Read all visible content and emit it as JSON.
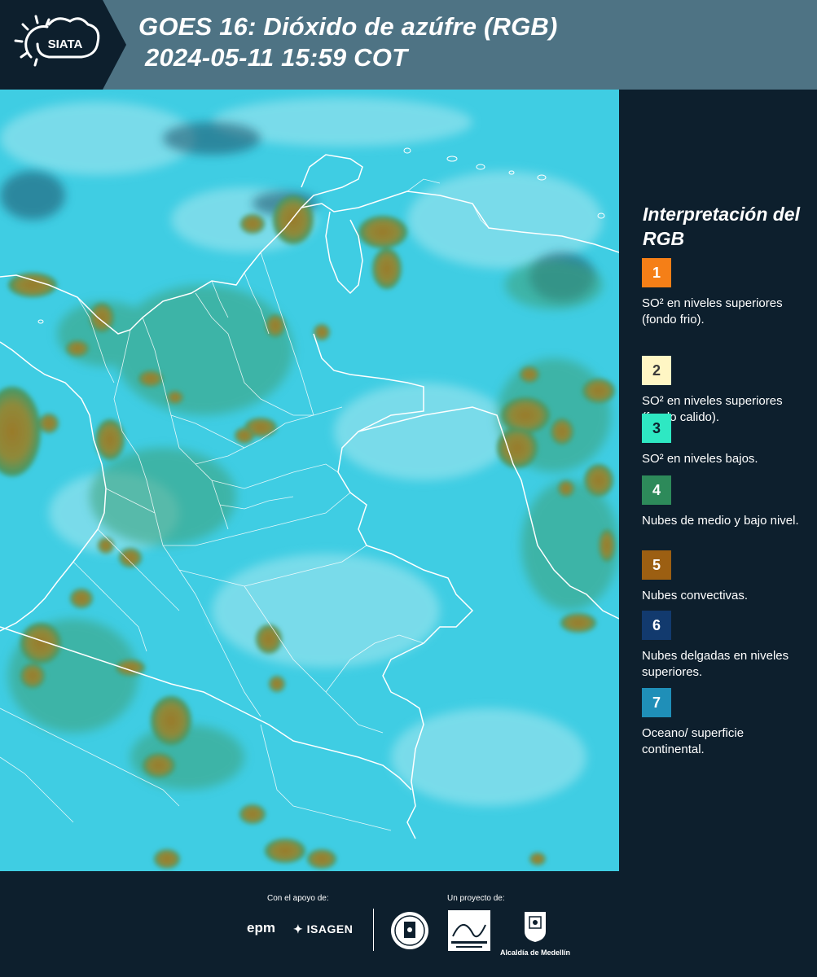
{
  "header": {
    "logo_text": "SIATA",
    "title_line1": "GOES 16: Dióxido de azúfre (RGB)",
    "title_line2": "2024-05-11 15:59 COT"
  },
  "legend": {
    "title": "Interpretación del RGB",
    "items": [
      {
        "number": "1",
        "color": "#f57f17",
        "number_color": "#ffffff",
        "text": "SO² en niveles superiores (fondo frio)."
      },
      {
        "number": "2",
        "color": "#fff6c4",
        "number_color": "#3a3a3a",
        "text": "SO² en niveles superiores (fondo calido)."
      },
      {
        "number": "3",
        "color": "#2ee8c3",
        "number_color": "#0d1f2d",
        "text": "SO² en niveles bajos."
      },
      {
        "number": "4",
        "color": "#2d8a5a",
        "number_color": "#ffffff",
        "text": "Nubes de medio y bajo nivel."
      },
      {
        "number": "5",
        "color": "#9c5f12",
        "number_color": "#ffffff",
        "text": "Nubes convectivas."
      },
      {
        "number": "6",
        "color": "#123a6e",
        "number_color": "#ffffff",
        "text": "Nubes delgadas en niveles superiores."
      },
      {
        "number": "7",
        "color": "#1f8fb8",
        "number_color": "#ffffff",
        "text": "Oceano/ superficie continental."
      }
    ]
  },
  "footer": {
    "support_label": "Con el apoyo de:",
    "project_label": "Un proyecto de:",
    "sponsor_1": "epm",
    "sponsor_2": "ISAGEN",
    "partner_label": "Alcaldía de Medellín"
  },
  "colors": {
    "header_bg": "#4e7384",
    "panel_bg": "#0d1f2d",
    "ocean_cyan": "#3fd0e6",
    "cloud_olive": "#8a8a36"
  }
}
